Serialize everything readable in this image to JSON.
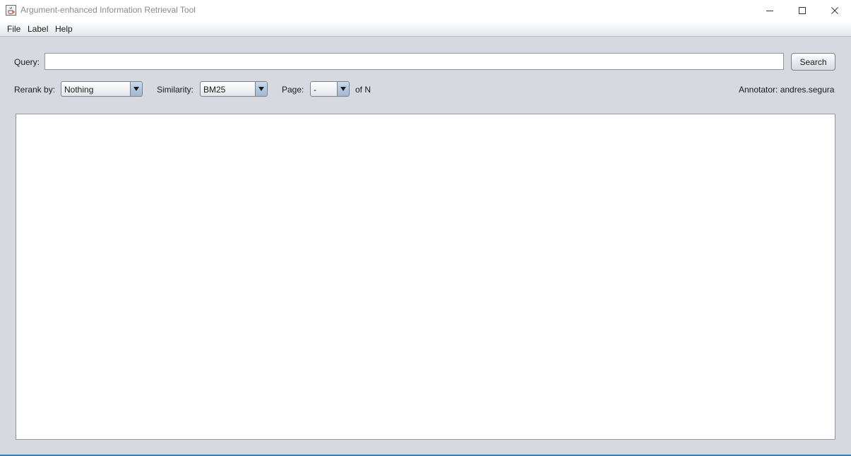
{
  "window": {
    "title": "Argument-enhanced Information Retrieval Tool",
    "app_icon": "java-cup-icon",
    "controls": [
      "minimize-icon",
      "maximize-icon",
      "close-icon"
    ]
  },
  "menu": {
    "items": [
      {
        "label": "File"
      },
      {
        "label": "Label"
      },
      {
        "label": "Help"
      }
    ]
  },
  "query": {
    "label": "Query:",
    "value": "",
    "search_label": "Search"
  },
  "controls": {
    "rerank_label": "Rerank by:",
    "rerank_value": "Nothing",
    "similarity_label": "Similarity:",
    "similarity_value": "BM25",
    "page_label": "Page:",
    "page_value": "-",
    "of_label": "of N",
    "annotator_text": "Annotator: andres.segura"
  },
  "colors": {
    "background": "#d6d9df",
    "combo_arrow": "#9fb8d3",
    "accent_border": "#3c7fb1"
  }
}
